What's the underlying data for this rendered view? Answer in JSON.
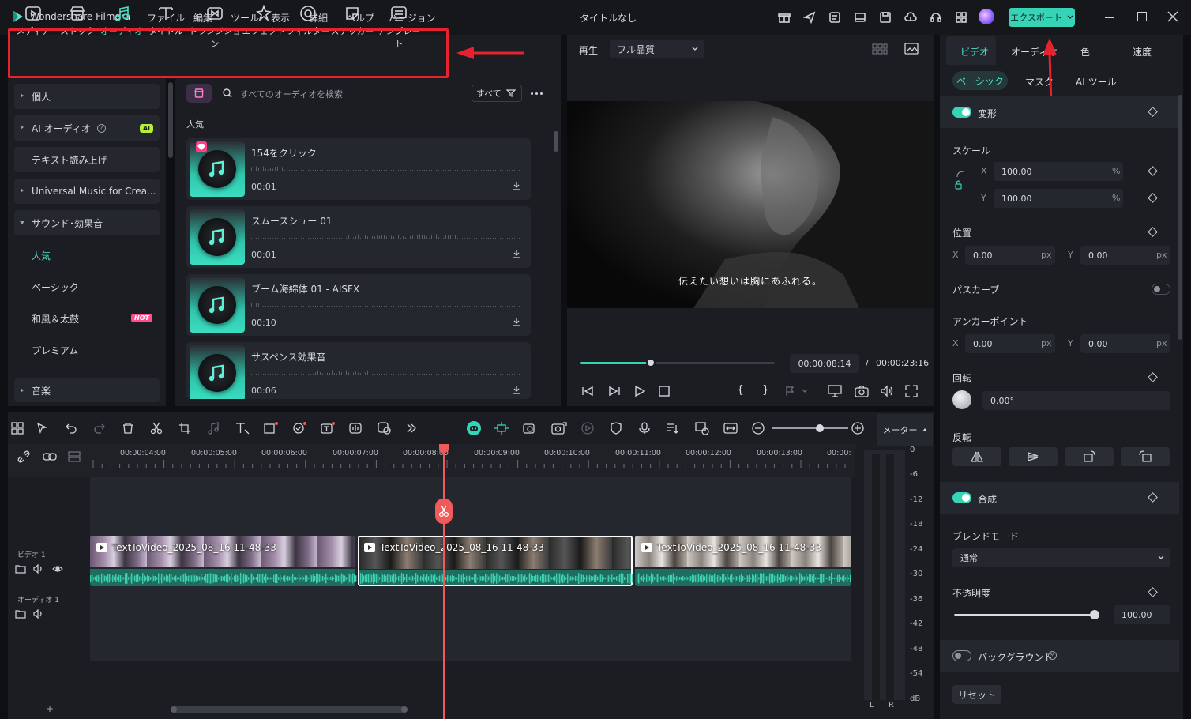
{
  "titlebar": {
    "app_name": "Wondershare Filmora",
    "doc_title": "タイトルなし",
    "menu": [
      "ファイル",
      "編集",
      "ツール",
      "表示",
      "詳細",
      "ヘルプ",
      "バージョン"
    ],
    "export_label": "エクスポート"
  },
  "toolbar": {
    "tools": [
      {
        "label": "メディア",
        "icon": "media-icon"
      },
      {
        "label": "ストック",
        "icon": "stock-icon"
      },
      {
        "label": "オーディオ",
        "icon": "audio-icon",
        "active": true
      },
      {
        "label": "タイトル",
        "icon": "title-icon"
      },
      {
        "label": "トランジション",
        "icon": "transition-icon"
      },
      {
        "label": "エフェクト",
        "icon": "effect-icon"
      },
      {
        "label": "フィルター",
        "icon": "filter-icon"
      },
      {
        "label": "ステッカー",
        "icon": "sticker-icon"
      },
      {
        "label": "テンプレート",
        "icon": "template-icon"
      }
    ]
  },
  "sidebar": {
    "items": [
      {
        "label": "個人"
      },
      {
        "label": "AI オーディオ",
        "badge": "AI"
      },
      {
        "label": "テキスト読み上げ"
      },
      {
        "label": "Universal Music for Crea..."
      },
      {
        "label": "サウンド･効果音"
      },
      {
        "label": "音楽"
      }
    ],
    "sub_items": [
      {
        "label": "人気",
        "active": true
      },
      {
        "label": "ベーシック"
      },
      {
        "label": "和風＆太鼓",
        "badge": "HOT"
      },
      {
        "label": "プレミアム"
      }
    ]
  },
  "library": {
    "search_placeholder": "すべてのオーディオを検索",
    "filter_label": "すべて",
    "section_title": "人気",
    "cards": [
      {
        "title": "154をクリック",
        "duration": "00:01"
      },
      {
        "title": "スムースシュー 01",
        "duration": "00:01"
      },
      {
        "title": "ブーム海綿体 01 - AISFX",
        "duration": "00:10"
      },
      {
        "title": "サスペンス効果音",
        "duration": "00:06"
      }
    ]
  },
  "preview": {
    "play_label": "再生",
    "quality": "フル品質",
    "subtitle": "伝えたい想いは胸にあふれる。",
    "current_time": "00:00:08:14",
    "separator": "/",
    "total_time": "00:00:23:16",
    "progress": 0.36
  },
  "props": {
    "tabs": [
      "ビデオ",
      "オーディオ",
      "色",
      "速度"
    ],
    "subtabs": [
      "ベーシック",
      "マスク",
      "AI ツール"
    ],
    "transform_label": "変形",
    "scale_label": "スケール",
    "scale_x": "100.00",
    "scale_y": "100.00",
    "pct": "%",
    "position_label": "位置",
    "pos_x": "0.00",
    "pos_y": "0.00",
    "px": "px",
    "path_curve_label": "パスカーブ",
    "anchor_label": "アンカーポイント",
    "anchor_x": "0.00",
    "anchor_y": "0.00",
    "rotate_label": "回転",
    "rotate_value": "0.00°",
    "flip_label": "反転",
    "composite_label": "合成",
    "blend_label": "ブレンドモード",
    "blend_value": "通常",
    "opacity_label": "不透明度",
    "opacity_value": "100.00",
    "background_label": "バックグラウンド",
    "reset_label": "リセット",
    "x": "X",
    "y": "Y"
  },
  "timeline": {
    "meter_label": "メーター",
    "ruler": [
      "00:00:04:00",
      "00:00:05:00",
      "00:00:06:00",
      "00:00:07:00",
      "00:00:08:00",
      "00:00:09:00",
      "00:00:10:00",
      "00:00:11:00",
      "00:00:12:00",
      "00:00:13:00",
      "00:00:"
    ],
    "video_track": "ビデオ 1",
    "audio_track": "オーディオ 1",
    "clips": [
      "TextToVideo_2025_08_16 11-48-33",
      "TextToVideo_2025_08_16 11-48-33",
      "TextToVideo_2025_08_16 11-48-33"
    ],
    "db_labels": [
      "0",
      "-6",
      "-12",
      "-18",
      "-24",
      "-30",
      "-36",
      "-42",
      "-48",
      "-54",
      "dB"
    ],
    "lr": [
      "L",
      "R"
    ]
  },
  "colors": {
    "accent": "#37d3b6",
    "highlight": "#e6222e",
    "playhead": "#f05a5a"
  }
}
